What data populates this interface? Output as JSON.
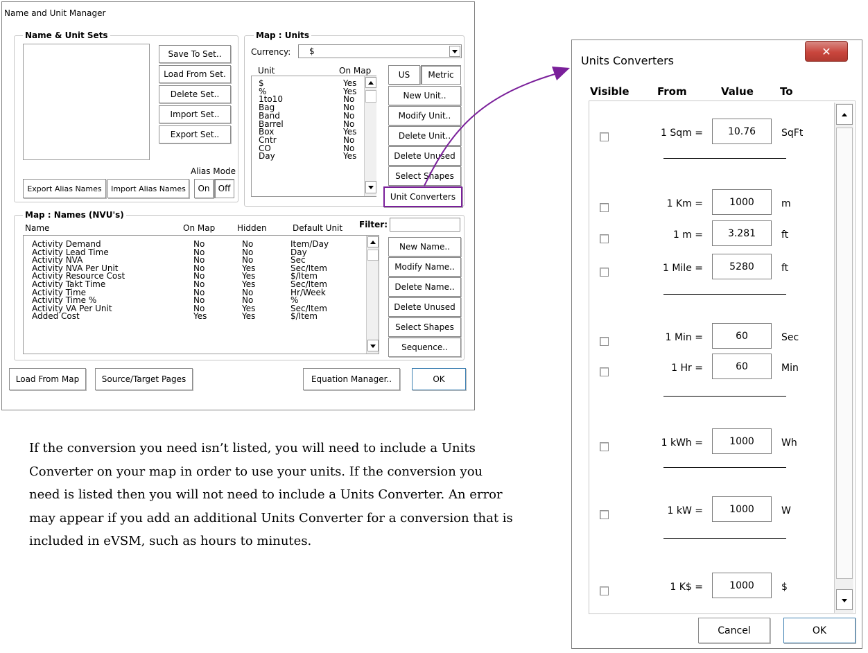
{
  "nvu": {
    "title": "Name and Unit Manager",
    "sets": {
      "legend": "Name & Unit Sets",
      "buttons": [
        "Save To Set..",
        "Load From Set.",
        "Delete Set..",
        "Import Set..",
        "Export Set.."
      ],
      "alias_mode_label": "Alias Mode",
      "export_alias": "Export Alias Names",
      "import_alias": "Import Alias Names",
      "on": "On",
      "off": "Off"
    },
    "units": {
      "legend": "Map : Units",
      "currency_label": "Currency:",
      "currency_value": "$",
      "col_unit": "Unit",
      "col_onmap": "On Map",
      "rows": [
        {
          "unit": "$",
          "onmap": "Yes"
        },
        {
          "unit": "%",
          "onmap": "Yes"
        },
        {
          "unit": "1to10",
          "onmap": "No"
        },
        {
          "unit": "Bag",
          "onmap": "No"
        },
        {
          "unit": "Band",
          "onmap": "No"
        },
        {
          "unit": "Barrel",
          "onmap": "No"
        },
        {
          "unit": "Box",
          "onmap": "Yes"
        },
        {
          "unit": "Cntr",
          "onmap": "No"
        },
        {
          "unit": "CO",
          "onmap": "No"
        },
        {
          "unit": "Day",
          "onmap": "Yes"
        }
      ],
      "tab_us": "US",
      "tab_metric": "Metric",
      "buttons": [
        "New Unit..",
        "Modify Unit..",
        "Delete Unit..",
        "Delete Unused",
        "Select Shapes",
        "Unit Converters"
      ]
    },
    "names": {
      "legend": "Map : Names (NVU's)",
      "col_name": "Name",
      "col_onmap": "On Map",
      "col_hidden": "Hidden",
      "col_default": "Default Unit",
      "filter_label": "Filter:",
      "filter_value": "",
      "rows": [
        {
          "name": "Activity Demand",
          "onmap": "No",
          "hidden": "No",
          "unit": "Item/Day"
        },
        {
          "name": "Activity Lead Time",
          "onmap": "No",
          "hidden": "No",
          "unit": "Day"
        },
        {
          "name": "Activity NVA",
          "onmap": "No",
          "hidden": "No",
          "unit": "Sec"
        },
        {
          "name": "Activity NVA Per Unit",
          "onmap": "No",
          "hidden": "Yes",
          "unit": "Sec/Item"
        },
        {
          "name": "Activity Resource Cost",
          "onmap": "No",
          "hidden": "Yes",
          "unit": "$/Item"
        },
        {
          "name": "Activity Takt Time",
          "onmap": "No",
          "hidden": "Yes",
          "unit": "Sec/Item"
        },
        {
          "name": "Activity Time",
          "onmap": "No",
          "hidden": "No",
          "unit": "Hr/Week"
        },
        {
          "name": "Activity Time %",
          "onmap": "No",
          "hidden": "No",
          "unit": "%"
        },
        {
          "name": "Activity VA Per Unit",
          "onmap": "No",
          "hidden": "Yes",
          "unit": "Sec/Item"
        },
        {
          "name": "Added Cost",
          "onmap": "Yes",
          "hidden": "Yes",
          "unit": "$/Item"
        }
      ],
      "buttons": [
        "New Name..",
        "Modify Name..",
        "Delete Name..",
        "Delete Unused",
        "Select Shapes",
        "Sequence.."
      ]
    },
    "footer": {
      "load_from_map": "Load From Map",
      "source_target": "Source/Target Pages",
      "equation_manager": "Equation Manager..",
      "ok": "OK"
    }
  },
  "converters": {
    "title": "Units Converters",
    "col_visible": "Visible",
    "col_from": "From",
    "col_value": "Value",
    "col_to": "To",
    "rows": [
      {
        "from": "1 Sqm =",
        "value": "10.76",
        "to": "SqFt"
      },
      {
        "from": "1 Km =",
        "value": "1000",
        "to": "m"
      },
      {
        "from": "1 m =",
        "value": "3.281",
        "to": "ft"
      },
      {
        "from": "1 Mile =",
        "value": "5280",
        "to": "ft"
      },
      {
        "from": "1 Min =",
        "value": "60",
        "to": "Sec"
      },
      {
        "from": "1 Hr =",
        "value": "60",
        "to": "Min"
      },
      {
        "from": "1 kWh =",
        "value": "1000",
        "to": "Wh"
      },
      {
        "from": "1 kW =",
        "value": "1000",
        "to": "W"
      },
      {
        "from": "1 K$ =",
        "value": "1000",
        "to": "$"
      }
    ],
    "cancel": "Cancel",
    "ok": "OK"
  },
  "paragraph": "If the conversion you need isn’t listed, you will need to include a Units Converter on your map in order to use your units. If the conversion you need is listed then you will not need to include a Units Converter. An error may appear if you add an additional Units Converter for a conversion that is included in eVSM, such as hours to minutes.",
  "colors": {
    "arrow": "#7a1f9a",
    "highlight_border": "#7a1f9a",
    "dialog_border": "#7f7f7f",
    "close_button": "#c9463d"
  }
}
